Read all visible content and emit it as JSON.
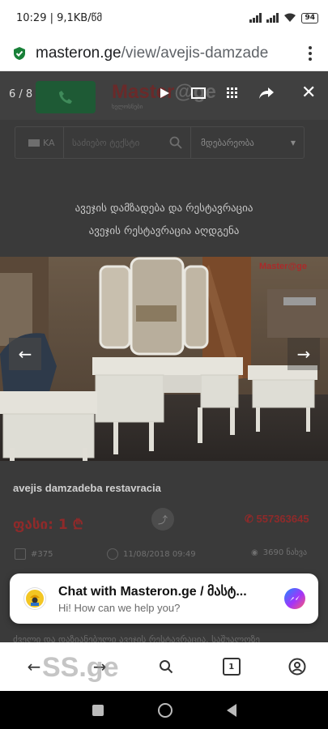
{
  "status_bar": {
    "time_info": "10:29 | 9,1KB/წმ",
    "battery": "94"
  },
  "browser": {
    "url_domain": "masteron.ge",
    "url_path": "/view/avejis-damzade"
  },
  "viewer": {
    "counter": "6 / 8"
  },
  "site": {
    "logo_main": "Master",
    "logo_accent": "@ge",
    "logo_sub": "ხელოსნები",
    "search": {
      "lang": "KA",
      "placeholder": "საძიებო ტექსტი",
      "location": "მდებარეობა"
    }
  },
  "listing": {
    "heading_1": "ავეჯის დამზადება და რესტავრაცია",
    "heading_2": "ავეჯის რესტავრაცია აღდგენა",
    "watermark": "Master@ge",
    "title": "avejis damzadeba restavracia",
    "price": "ფასი: 1 ₾",
    "phone": "557363645",
    "id": "#375",
    "date": "11/08/2018 09:49",
    "views": "3690 ნახვა",
    "description": "ძველი და დაზიანებული ავეჯის რესტავრაცია. საშუალოზე"
  },
  "chat": {
    "title": "Chat with Masteron.ge / მასტ...",
    "subtitle": "Hi! How can we help you?"
  },
  "toolbar": {
    "tabs_count": "1",
    "overlay_logo": "SS.ge"
  },
  "colors": {
    "accent_red": "#8f2a2a",
    "call_green": "#1e5a35",
    "secure_green": "#188038"
  }
}
